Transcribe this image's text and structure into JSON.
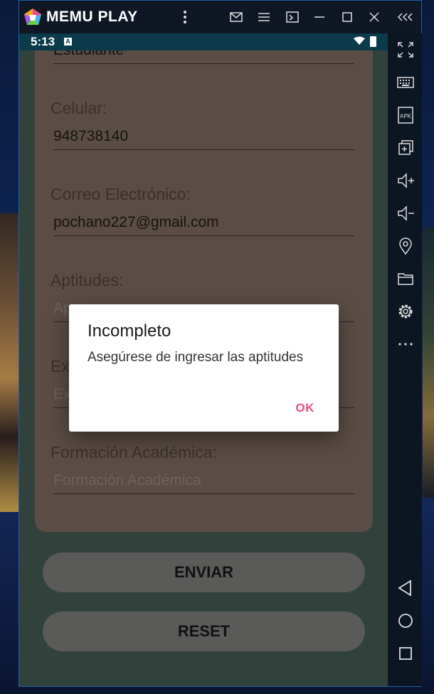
{
  "emulator": {
    "brand": "MEMU PLAY",
    "toolbar_icons": [
      "more-vert-icon",
      "mail-icon",
      "menu-icon",
      "screen-record-icon",
      "minimize-icon",
      "maximize-icon",
      "close-icon",
      "collapse-sidebar-icon"
    ],
    "sidebar_icons": [
      "fullscreen-icon",
      "keyboard-icon",
      "apk-icon",
      "multi-window-icon",
      "volume-up-icon",
      "volume-down-icon",
      "location-icon",
      "folder-icon",
      "settings-icon",
      "more-horiz-icon",
      "back-icon",
      "home-icon",
      "recents-icon"
    ],
    "apk_label": "APK"
  },
  "status_bar": {
    "time": "5:13",
    "badge": "A"
  },
  "form": {
    "occupation_value": "Estudiante",
    "celular_label": "Celular:",
    "celular_value": "948738140",
    "correo_label": "Correo Electrónico:",
    "correo_value": "pochano227@gmail.com",
    "aptitudes_label": "Aptitudes:",
    "aptitudes_hint": "Ap",
    "experiencia_label": "Ex",
    "experiencia_hint": "Ex",
    "formacion_label": "Formación Académica:",
    "formacion_hint": "Formación Académica"
  },
  "buttons": {
    "send": "ENVIAR",
    "reset": "RESET"
  },
  "dialog": {
    "title": "Incompleto",
    "message": "Asegúrese de ingresar las aptitudes",
    "ok": "OK"
  }
}
